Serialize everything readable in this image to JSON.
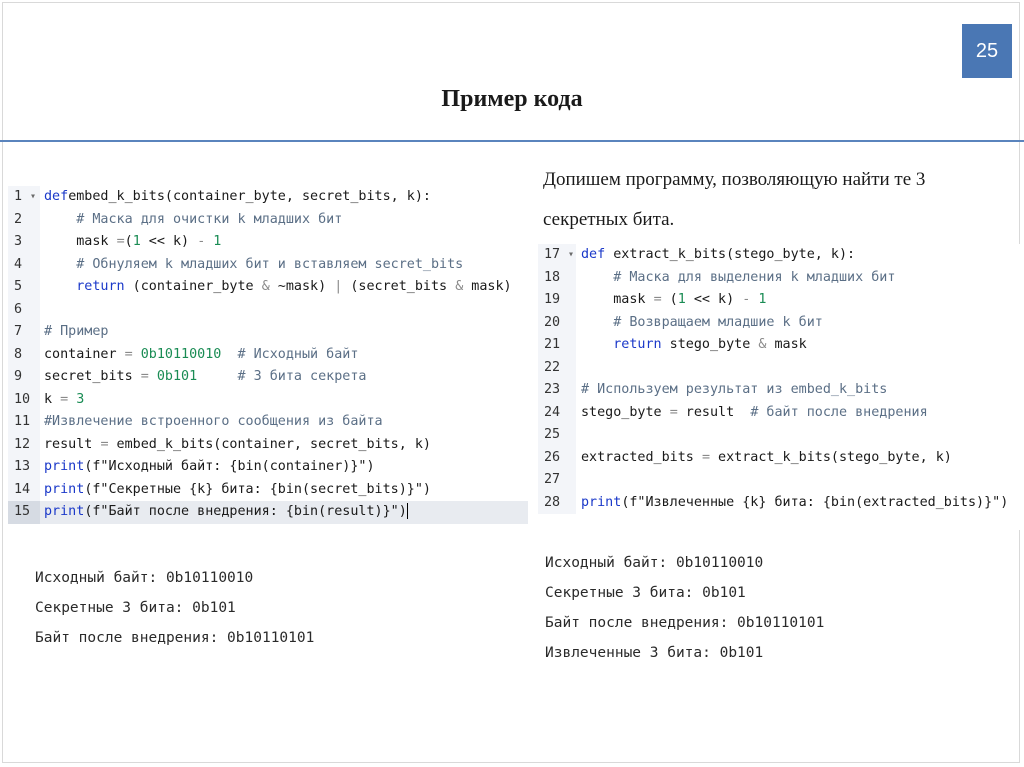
{
  "slide": {
    "number": "25",
    "title": "Пример кода",
    "description": "Допишем программу, позволяющую найти те 3 секретных бита."
  },
  "colors": {
    "accent": "#4a77b4",
    "keyword": "#1b39c9",
    "comment": "#5b6f86",
    "number": "#1a8c54",
    "gutter": "#f3f5f9"
  },
  "left_code": {
    "lines": [
      {
        "num": "1",
        "fold": true,
        "tokens": [
          [
            "kw",
            "def"
          ],
          [
            "",
            "embed_k_bits(container_byte, secret_bits, k):"
          ]
        ]
      },
      {
        "num": "2",
        "tokens": [
          [
            "",
            "    "
          ],
          [
            "com",
            "# Маска для очистки k младших бит"
          ]
        ]
      },
      {
        "num": "3",
        "tokens": [
          [
            "",
            "    mask "
          ],
          [
            "op",
            "="
          ],
          [
            "",
            "("
          ],
          [
            "num",
            "1"
          ],
          [
            "",
            " << k) "
          ],
          [
            "op",
            "-"
          ],
          [
            "",
            ""
          ],
          [
            "num",
            " 1"
          ]
        ]
      },
      {
        "num": "4",
        "tokens": [
          [
            "",
            "    "
          ],
          [
            "com",
            "# Обнуляем k младших бит и вставляем secret_bits"
          ]
        ]
      },
      {
        "num": "5",
        "tokens": [
          [
            "",
            "    "
          ],
          [
            "kw",
            "return"
          ],
          [
            "",
            " (container_byte "
          ],
          [
            "op",
            "&"
          ],
          [
            "",
            " ~mask) "
          ],
          [
            "op",
            "|"
          ],
          [
            "",
            " (secret_bits "
          ],
          [
            "op",
            "&"
          ],
          [
            "",
            " mask)"
          ]
        ]
      },
      {
        "num": "6",
        "tokens": []
      },
      {
        "num": "7",
        "tokens": [
          [
            "com",
            "# Пример"
          ]
        ]
      },
      {
        "num": "8",
        "tokens": [
          [
            "",
            "container "
          ],
          [
            "op",
            "="
          ],
          [
            "",
            " "
          ],
          [
            "num",
            "0b10110010"
          ],
          [
            "",
            "  "
          ],
          [
            "com",
            "# Исходный байт"
          ]
        ]
      },
      {
        "num": "9",
        "tokens": [
          [
            "",
            "secret_bits "
          ],
          [
            "op",
            "="
          ],
          [
            "",
            " "
          ],
          [
            "num",
            "0b101"
          ],
          [
            "",
            "     "
          ],
          [
            "com",
            "# 3 бита секрета"
          ]
        ]
      },
      {
        "num": "10",
        "tokens": [
          [
            "",
            "k "
          ],
          [
            "op",
            "="
          ],
          [
            "",
            " "
          ],
          [
            "num",
            "3"
          ]
        ]
      },
      {
        "num": "11",
        "tokens": [
          [
            "com",
            "#Извлечение встроенного сообщения из байта"
          ]
        ]
      },
      {
        "num": "12",
        "tokens": [
          [
            "",
            "result "
          ],
          [
            "op",
            "="
          ],
          [
            "",
            " embed_k_bits(container, secret_bits, k)"
          ]
        ]
      },
      {
        "num": "13",
        "tokens": [
          [
            "kw",
            "print"
          ],
          [
            "",
            "(f\"Исходный байт: {bin(container)}\")"
          ]
        ]
      },
      {
        "num": "14",
        "tokens": [
          [
            "kw",
            "print"
          ],
          [
            "",
            "(f\"Секретные {k} бита: {bin(secret_bits)}\")"
          ]
        ]
      },
      {
        "num": "15",
        "active": true,
        "cursor": true,
        "tokens": [
          [
            "kw",
            "print"
          ],
          [
            "",
            "(f\"Байт после внедрения: {bin(result)}\")"
          ]
        ]
      }
    ]
  },
  "right_code": {
    "lines": [
      {
        "num": "17",
        "fold": true,
        "tokens": [
          [
            "kw",
            "def"
          ],
          [
            "",
            " extract_k_bits(stego_byte, k):"
          ]
        ]
      },
      {
        "num": "18",
        "tokens": [
          [
            "",
            "    "
          ],
          [
            "com",
            "# Маска для выделения k младших бит"
          ]
        ]
      },
      {
        "num": "19",
        "tokens": [
          [
            "",
            "    mask "
          ],
          [
            "op",
            "="
          ],
          [
            "",
            " ("
          ],
          [
            "num",
            "1"
          ],
          [
            "",
            " << k) "
          ],
          [
            "op",
            "-"
          ],
          [
            "",
            " "
          ],
          [
            "num",
            "1"
          ]
        ]
      },
      {
        "num": "20",
        "tokens": [
          [
            "",
            "    "
          ],
          [
            "com",
            "# Возвращаем младшие k бит"
          ]
        ]
      },
      {
        "num": "21",
        "tokens": [
          [
            "",
            "    "
          ],
          [
            "kw",
            "return"
          ],
          [
            "",
            " stego_byte "
          ],
          [
            "op",
            "&"
          ],
          [
            "",
            " mask"
          ]
        ]
      },
      {
        "num": "22",
        "tokens": []
      },
      {
        "num": "23",
        "tokens": [
          [
            "com",
            "# Используем результат из embed_k_bits"
          ]
        ]
      },
      {
        "num": "24",
        "tokens": [
          [
            "",
            "stego_byte "
          ],
          [
            "op",
            "="
          ],
          [
            "",
            " result  "
          ],
          [
            "com",
            "# байт после внедрения"
          ]
        ]
      },
      {
        "num": "25",
        "tokens": []
      },
      {
        "num": "26",
        "tokens": [
          [
            "",
            "extracted_bits "
          ],
          [
            "op",
            "="
          ],
          [
            "",
            " extract_k_bits(stego_byte, k)"
          ]
        ]
      },
      {
        "num": "27",
        "tokens": []
      },
      {
        "num": "28",
        "tokens": [
          [
            "kw",
            "print"
          ],
          [
            "",
            "(f\"Извлеченные {k} бита: {bin(extracted_bits)}\")"
          ]
        ]
      }
    ]
  },
  "left_output": [
    "Исходный байт: 0b10110010",
    "Секретные 3 бита: 0b101",
    "Байт после внедрения: 0b10110101"
  ],
  "right_output": [
    "Исходный байт: 0b10110010",
    "Секретные 3 бита: 0b101",
    "Байт после внедрения: 0b10110101",
    "Извлеченные 3 бита: 0b101"
  ]
}
